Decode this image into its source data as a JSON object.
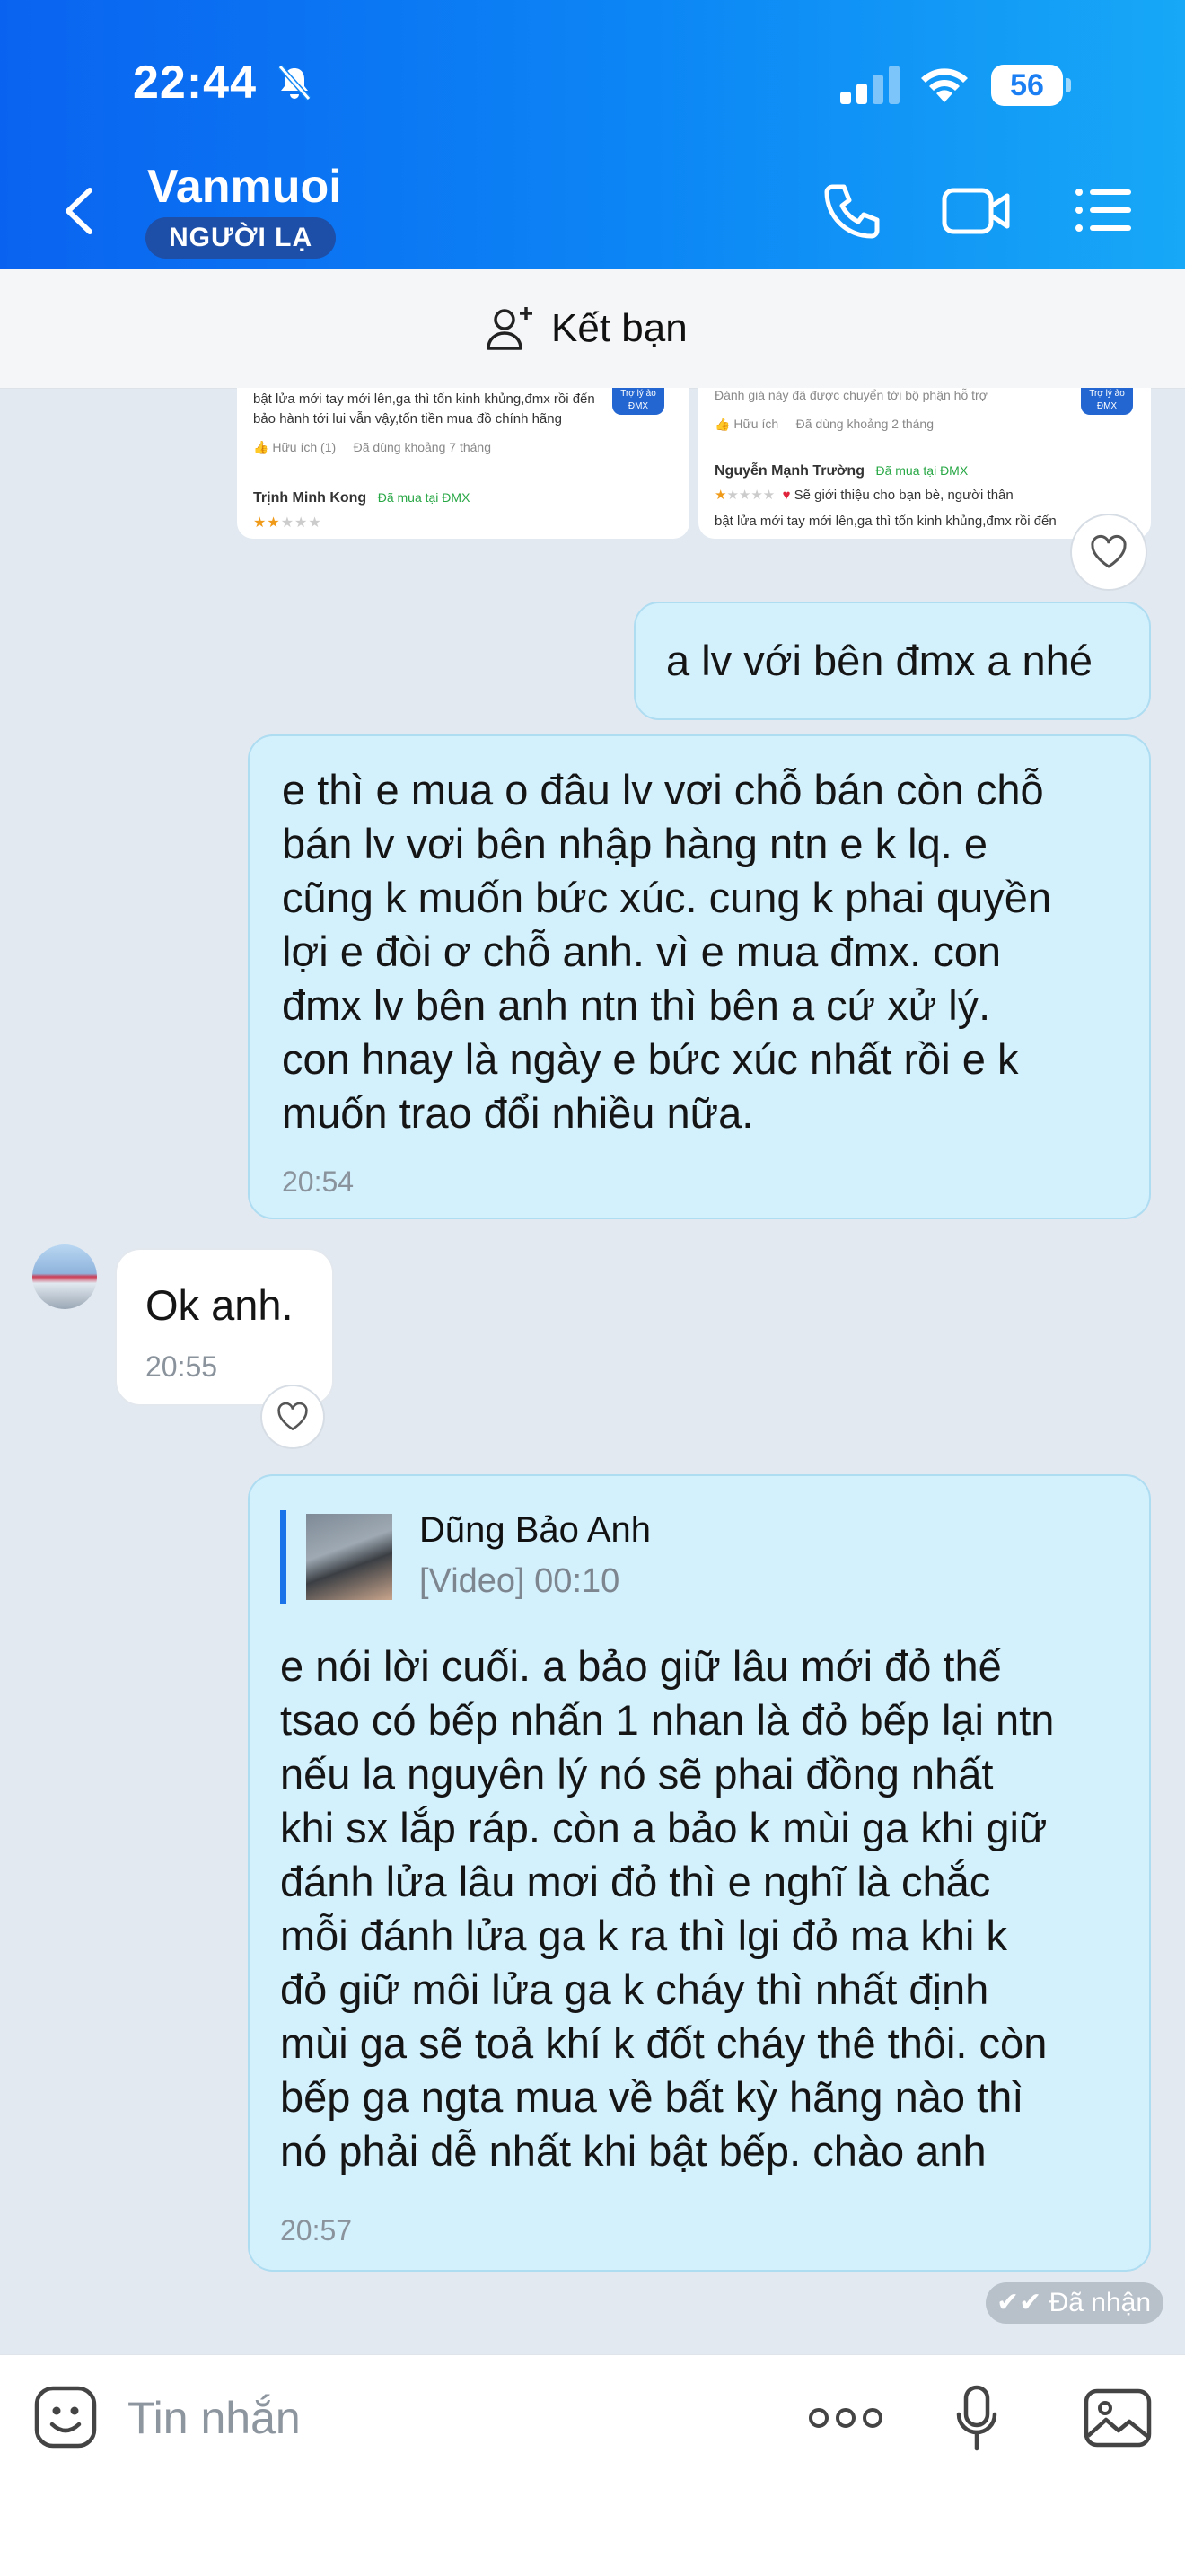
{
  "status_bar": {
    "time": "22:44",
    "battery": "56"
  },
  "header": {
    "contact_name": "Vanmuoi",
    "badge": "NGƯỜI LẠ"
  },
  "friend_bar": {
    "label": "Kết bạn"
  },
  "shared_image": {
    "left": {
      "line1": "bật lửa mới tay mới lên,ga thì tốn kinh khủng,đmx rồi đến",
      "line2": "bảo hành tới lui vẫn vậy,tốn tiền mua đồ chính hãng",
      "helpful": "Hữu ích (1)",
      "used": "Đã dùng khoảng 7 tháng",
      "reviewer": "Trịnh Minh Kong",
      "bought": "Đã mua tại ĐMX",
      "tag": "Trợ lý ảo ĐMX"
    },
    "right": {
      "line1": "Đánh giá này đã được chuyển tới bộ phận hỗ trợ",
      "helpful": "Hữu ích",
      "used": "Đã dùng khoảng 2 tháng",
      "reviewer": "Nguyễn Mạnh Trường",
      "bought": "Đã mua tại ĐMX",
      "recommend": "Sẽ giới thiệu cho bạn bè, người thân",
      "line2": "bật lửa mới tay mới lên,ga thì tốn kinh khủng,đmx rồi đến",
      "tag": "Trợ lý ảo ĐMX"
    }
  },
  "messages": [
    {
      "text": "a lv với bên đmx a nhé"
    },
    {
      "text": "e thì e mua o đâu lv vơi chỗ bán còn chỗ\nbán lv vơi bên nhập hàng ntn e k lq. e\ncũng k muốn bức xúc. cung k phai quyền\nlợi e đòi ơ chỗ anh. vì e mua đmx. con\nđmx lv bên anh ntn thì bên a cứ xử lý.\ncon hnay là ngày e bức xúc nhất rồi e k\nmuốn trao đổi nhiều nữa.",
      "time": "20:54"
    },
    {
      "text": "Ok anh.",
      "time": "20:55"
    },
    {
      "quote_author": "Dũng Bảo Anh",
      "quote_sub": "[Video] 00:10",
      "text": "e nói lời cuối. a bảo giữ lâu mới đỏ thế\ntsao có bếp nhấn 1 nhan là đỏ bếp lại ntn\nnếu la nguyên lý nó sẽ phai đồng nhất\nkhi sx lắp ráp. còn a bảo k mùi ga khi giữ\nđánh lửa lâu mơi đỏ thì e nghĩ là chắc\nmỗi đánh lửa ga k ra thì lgi đỏ ma khi k\nđỏ giữ môi lửa ga k cháy thì nhất định\nmùi ga sẽ toả khí k đốt cháy thê thôi. còn\nbếp ga ngta mua về bất kỳ hãng nào thì\nnó phải dễ nhất khi bật bếp. chào anh",
      "time": "20:57"
    }
  ],
  "read_status": "Đã nhận",
  "composer": {
    "placeholder": "Tin nhắn"
  },
  "colors": {
    "accent": "#0a63f0",
    "bubble_out": "#d3f0fd",
    "bubble_in": "#ffffff",
    "background": "#e2e9f1"
  }
}
